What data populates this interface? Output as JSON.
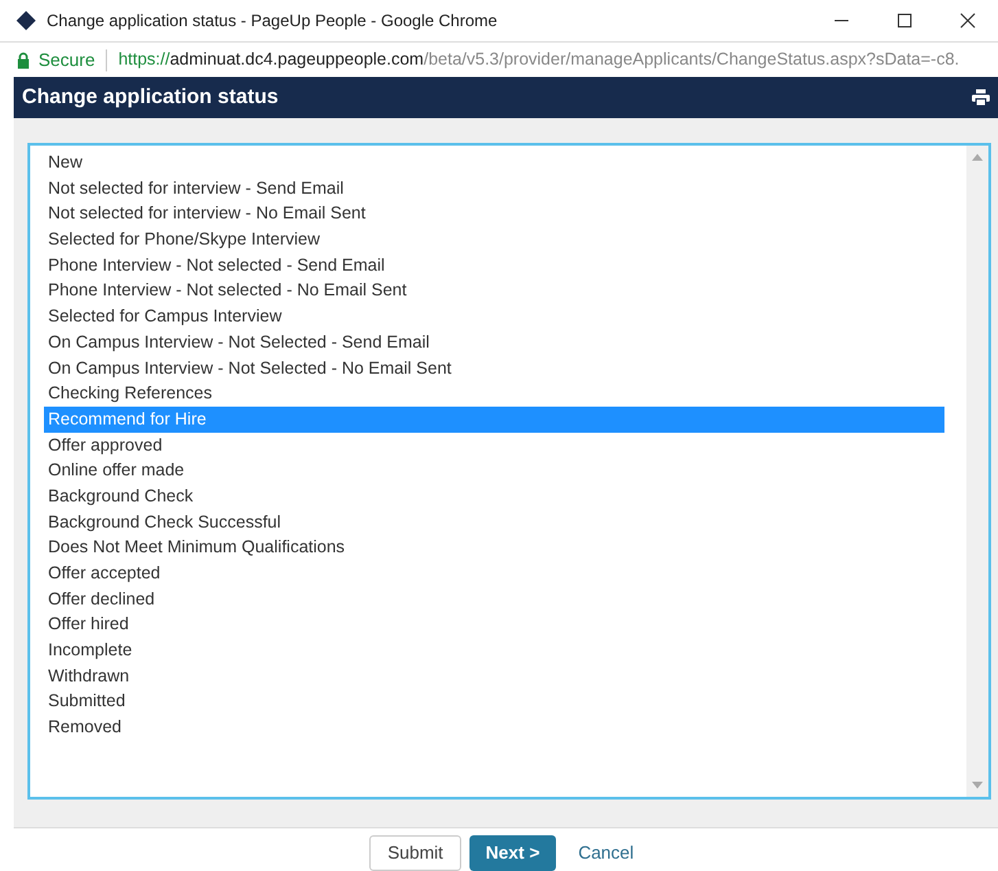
{
  "window": {
    "title": "Change application status - PageUp People - Google Chrome"
  },
  "address_bar": {
    "security": "Secure",
    "scheme": "https://",
    "host": "adminuat.dc4.pageuppeople.com",
    "path": "/beta/v5.3/provider/manageApplicants/ChangeStatus.aspx?sData=-c8."
  },
  "header": {
    "title": "Change application status"
  },
  "status_list": [
    {
      "label": "New",
      "selected": false
    },
    {
      "label": "Not selected for interview - Send Email",
      "selected": false
    },
    {
      "label": "Not selected for interview - No Email Sent",
      "selected": false
    },
    {
      "label": "Selected for Phone/Skype Interview",
      "selected": false
    },
    {
      "label": "Phone Interview - Not selected - Send Email",
      "selected": false
    },
    {
      "label": "Phone Interview - Not selected - No Email Sent",
      "selected": false
    },
    {
      "label": "Selected for Campus Interview",
      "selected": false
    },
    {
      "label": "On Campus Interview - Not Selected - Send Email",
      "selected": false
    },
    {
      "label": "On Campus Interview - Not Selected - No Email Sent",
      "selected": false
    },
    {
      "label": "Checking References",
      "selected": false
    },
    {
      "label": "Recommend for Hire",
      "selected": true
    },
    {
      "label": "Offer approved",
      "selected": false
    },
    {
      "label": "Online offer made",
      "selected": false
    },
    {
      "label": "Background Check",
      "selected": false
    },
    {
      "label": "Background Check Successful",
      "selected": false
    },
    {
      "label": "Does Not Meet Minimum Qualifications",
      "selected": false
    },
    {
      "label": "Offer accepted",
      "selected": false
    },
    {
      "label": "Offer declined",
      "selected": false
    },
    {
      "label": "Offer hired",
      "selected": false
    },
    {
      "label": "Incomplete",
      "selected": false
    },
    {
      "label": "Withdrawn",
      "selected": false
    },
    {
      "label": "Submitted",
      "selected": false
    },
    {
      "label": "Removed",
      "selected": false
    }
  ],
  "buttons": [
    {
      "label": "Submit",
      "kind": "secondary"
    },
    {
      "label": "Next >",
      "kind": "primary"
    },
    {
      "label": "Cancel",
      "kind": "link"
    }
  ]
}
